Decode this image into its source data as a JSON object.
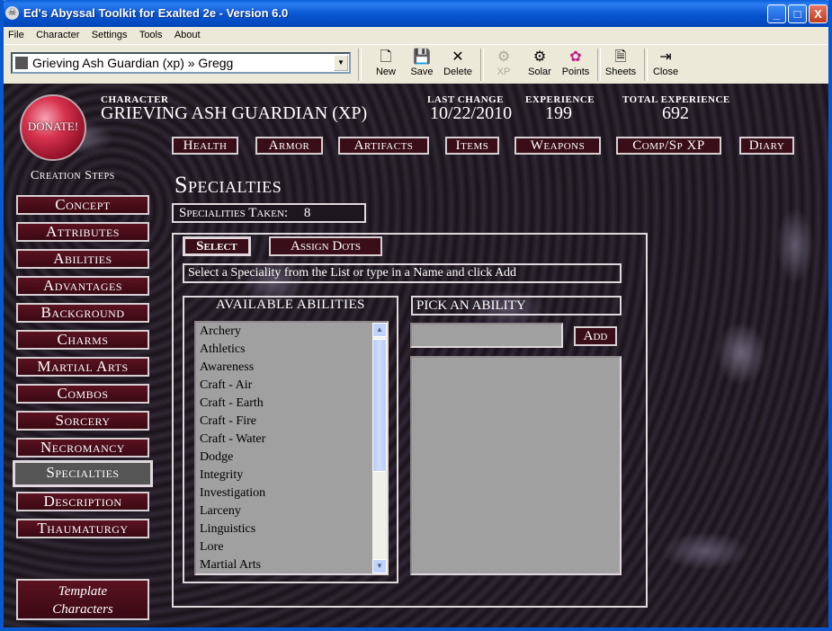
{
  "window": {
    "title": "Ed's Abyssal Toolkit for Exalted 2e - Version 6.0",
    "controls": [
      "_",
      "□",
      "X"
    ]
  },
  "menu": [
    "File",
    "Character",
    "Settings",
    "Tools",
    "About"
  ],
  "toolbar": {
    "character_select": "Grieving Ash Guardian (xp) » Gregg",
    "buttons": [
      {
        "label": "New",
        "icon": "new-document-icon"
      },
      {
        "label": "Save",
        "icon": "save-disk-icon"
      },
      {
        "label": "Delete",
        "icon": "delete-x-icon"
      },
      {
        "label": "XP",
        "icon": "xp-gear-icon",
        "disabled": true
      },
      {
        "label": "Solar",
        "icon": "solar-gear-icon"
      },
      {
        "label": "Points",
        "icon": "points-palette-icon"
      },
      {
        "label": "Sheets",
        "icon": "sheets-document-icon"
      },
      {
        "label": "Close",
        "icon": "close-door-icon"
      }
    ]
  },
  "header": {
    "donate_label": "DONATE!",
    "character_label": "CHARACTER",
    "character_name": "GRIEVING ASH GUARDIAN (XP)",
    "last_change_label": "LAST CHANGE",
    "last_change": "10/22/2010",
    "experience_label": "EXPERIENCE",
    "experience": "199",
    "total_experience_label": "TOTAL EXPERIENCE",
    "total_experience": "692"
  },
  "nav": [
    "Health",
    "Armor",
    "Artifacts",
    "Items",
    "Weapons",
    "Comp/Sp XP",
    "Diary"
  ],
  "creation": {
    "title": "Creation Steps",
    "steps": [
      "Concept",
      "Attributes",
      "Abilities",
      "Advantages",
      "Background",
      "Charms",
      "Martial Arts",
      "Combos",
      "Sorcery",
      "Necromancy",
      "Specialties",
      "Description",
      "Thaumaturgy"
    ],
    "active_step": "Specialties",
    "template_button": [
      "Template",
      "Characters"
    ]
  },
  "specialties": {
    "page_title": "Specialties",
    "taken_label": "Specialities Taken:",
    "taken_count": "8",
    "tab_select": "Select",
    "tab_assign": "Assign Dots",
    "hint": "Select a Speciality from the List or type in a Name and click Add",
    "available_title": "AVAILABLE ABILITIES",
    "available": [
      "Archery",
      "Athletics",
      "Awareness",
      "Craft - Air",
      "Craft - Earth",
      "Craft - Fire",
      "Craft - Water",
      "Dodge",
      "Integrity",
      "Investigation",
      "Larceny",
      "Linguistics",
      "Lore",
      "Martial Arts"
    ],
    "pick_title": "PICK AN ABILITY",
    "add_label": "Add",
    "name_value": ""
  }
}
